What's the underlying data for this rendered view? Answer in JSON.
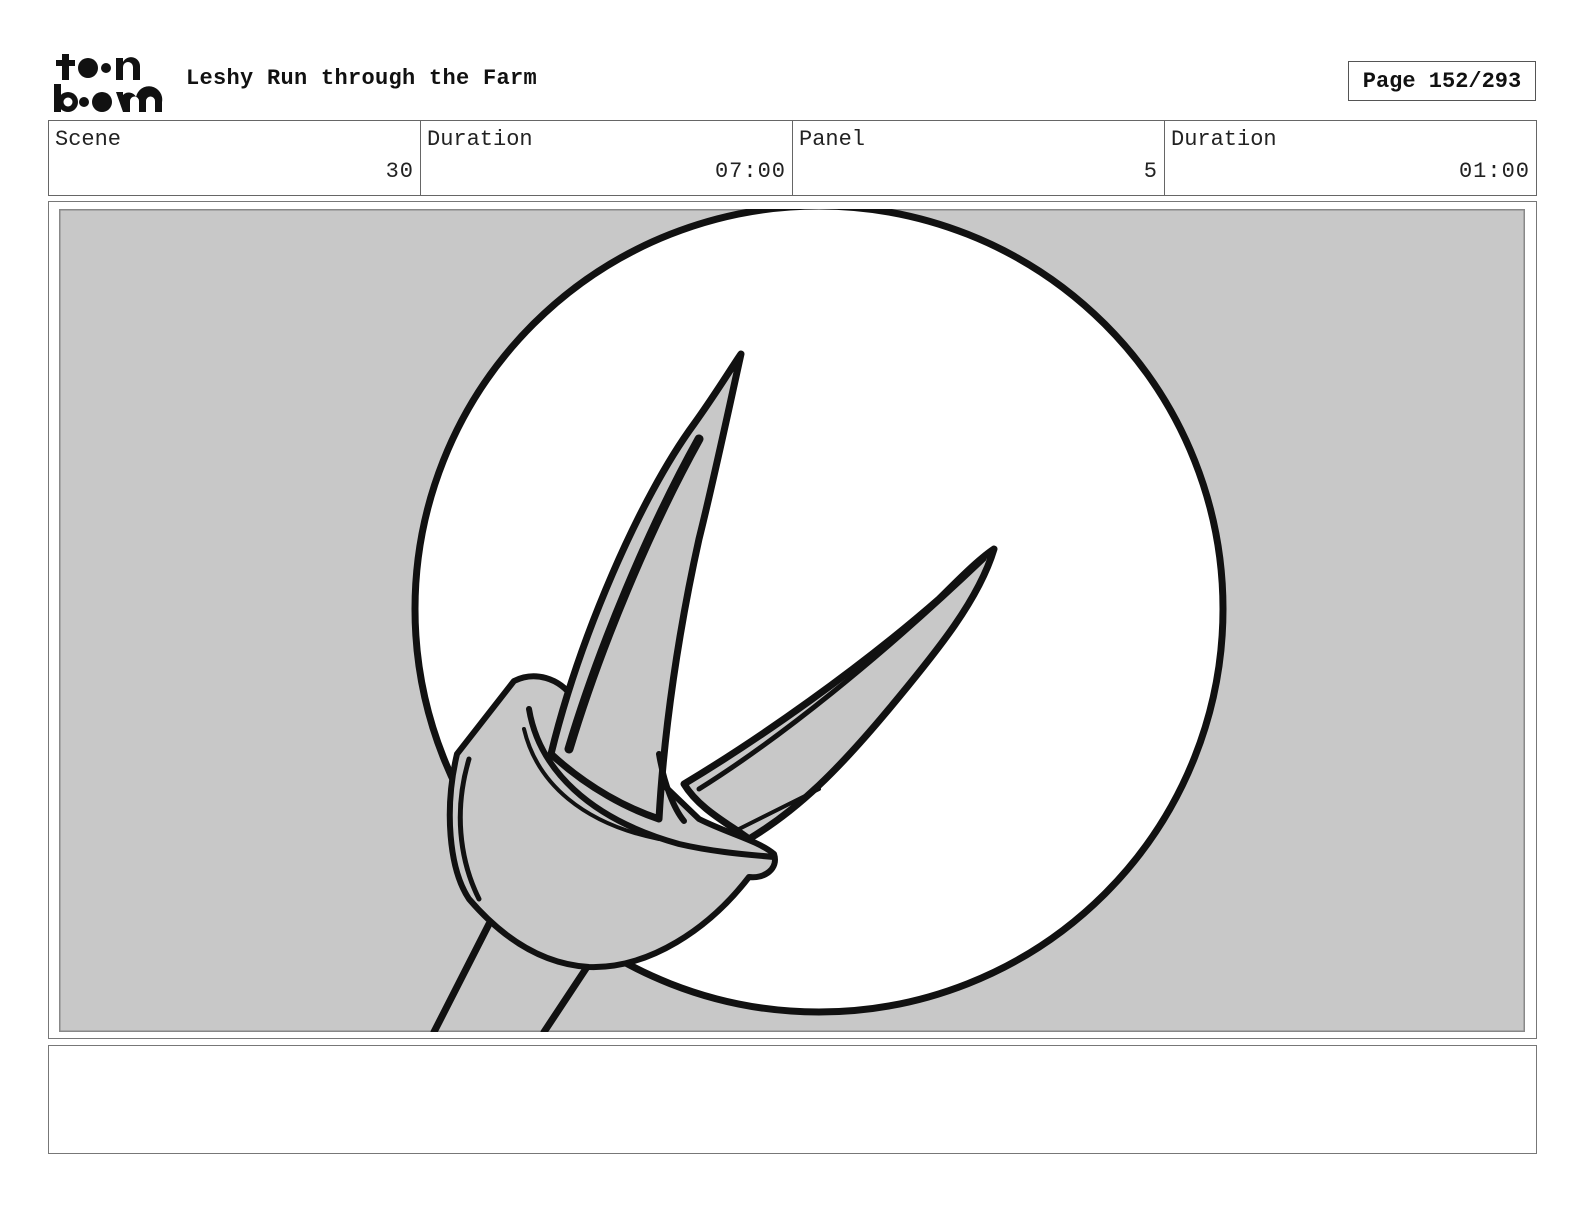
{
  "header": {
    "logo_text": "toon boom",
    "project_title": "Leshy Run through the Farm",
    "page_label": "Page 152/293"
  },
  "info": {
    "scene_label": "Scene",
    "scene_value": "30",
    "scene_duration_label": "Duration",
    "scene_duration_value": "07:00",
    "panel_label": "Panel",
    "panel_value": "5",
    "panel_duration_label": "Duration",
    "panel_duration_value": "01:00"
  },
  "panel": {
    "description": "",
    "background_color": "#c8c8c8",
    "circle_color": "#ffffff"
  },
  "notes": {
    "text": ""
  }
}
